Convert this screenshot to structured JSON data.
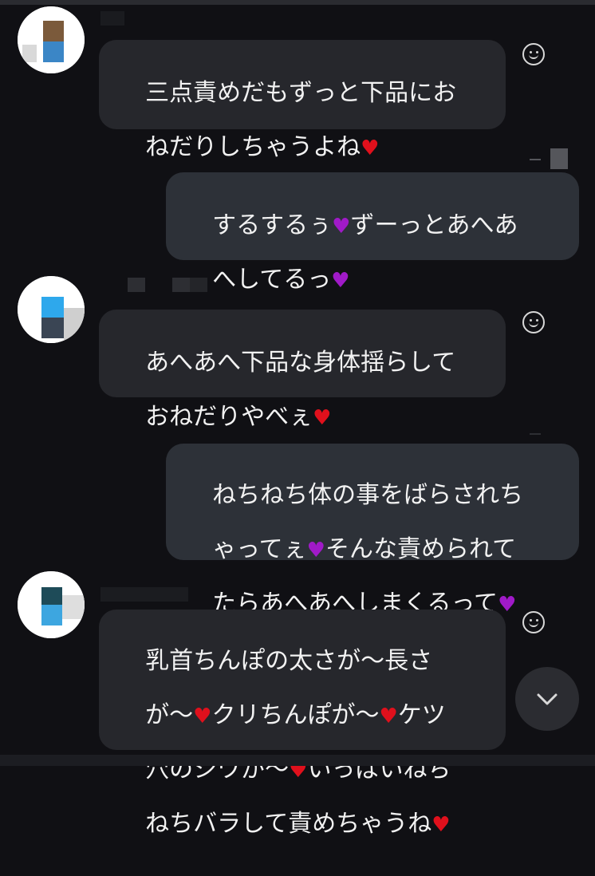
{
  "colors": {
    "background": "#101014",
    "incoming_bubble": "#26272c",
    "outgoing_bubble": "#2d3138",
    "heart_red": "#e0101c",
    "heart_purple": "#a01ac8"
  },
  "messages": [
    {
      "side": "incoming",
      "line1": "三点責めだもずっと下品にお",
      "line2": "ねだりしちゃうよね",
      "heart": "red-heart"
    },
    {
      "side": "outgoing",
      "line1_a": "するするぅ",
      "line1_b": "ずーっとあへあ",
      "line2": "へしてるっ",
      "heart": "purple-heart"
    },
    {
      "side": "incoming",
      "line1": "あへあへ下品な身体揺らして",
      "line2": "おねだりやべぇ",
      "heart": "red-heart"
    },
    {
      "side": "outgoing",
      "line1": "ねちねち体の事をばらされち",
      "line2_a": "ゃってぇ",
      "line2_b": "そんな責められて",
      "line3": "たらあへあへしまくるって",
      "heart": "purple-heart"
    },
    {
      "side": "incoming",
      "line1": "乳首ちんぽの太さが〜長さ",
      "line2_a": "が〜",
      "line2_b": "クリちんぽが〜",
      "line2_c": "ケツ",
      "line3_a": "穴のシワが〜",
      "line3_b": "いっぱいねち",
      "line4": "ねちバラして責めちゃうね",
      "heart": "red-heart"
    }
  ],
  "icons": {
    "heart_glyph": "♥",
    "reaction": "smiley-icon",
    "scroll": "chevron-down-icon"
  }
}
